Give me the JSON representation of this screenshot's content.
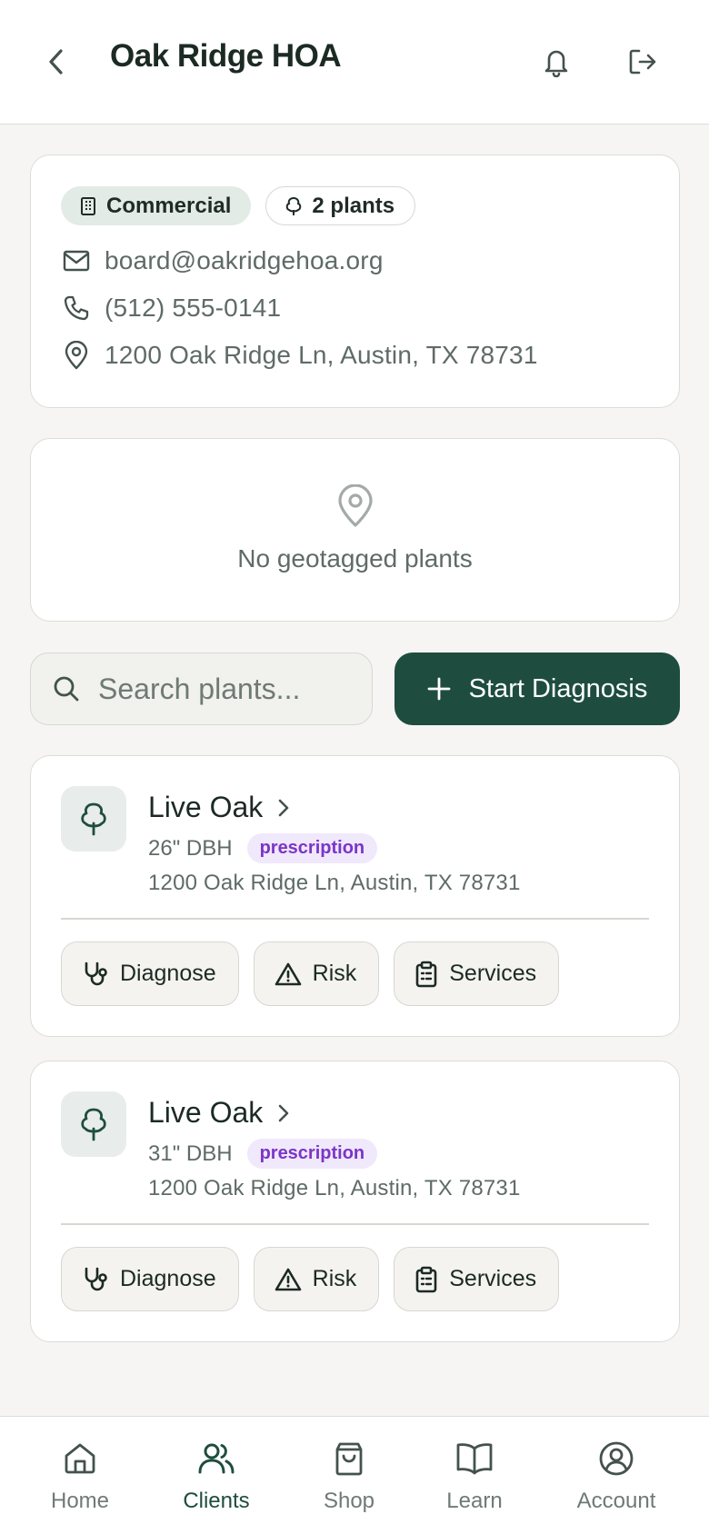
{
  "header": {
    "title": "Oak Ridge HOA",
    "back_icon": "chevron-left-icon",
    "notifications_icon": "bell-icon",
    "logout_icon": "logout-icon"
  },
  "client": {
    "type_badge": "Commercial",
    "plants_badge": "2 plants",
    "email": "board@oakridgehoa.org",
    "phone": "(512) 555-0141",
    "address": "1200 Oak Ridge Ln, Austin, TX 78731"
  },
  "map": {
    "empty_text": "No geotagged plants"
  },
  "search": {
    "placeholder": "Search plants..."
  },
  "start_diagnosis_label": "Start Diagnosis",
  "plants": [
    {
      "name": "Live Oak",
      "dbh": "26\" DBH",
      "tag": "prescription",
      "address": "1200 Oak Ridge Ln, Austin, TX 78731"
    },
    {
      "name": "Live Oak",
      "dbh": "31\" DBH",
      "tag": "prescription",
      "address": "1200 Oak Ridge Ln, Austin, TX 78731"
    }
  ],
  "plant_actions": {
    "diagnose": "Diagnose",
    "risk": "Risk",
    "services": "Services"
  },
  "nav": {
    "home": "Home",
    "clients": "Clients",
    "shop": "Shop",
    "learn": "Learn",
    "account": "Account",
    "active": "clients"
  },
  "colors": {
    "primary": "#1e4d3f",
    "prescription_text": "#7b35c8",
    "prescription_bg": "#f0e8fb",
    "commercial_bg": "#e2ebe6",
    "background": "#f6f5f3"
  }
}
